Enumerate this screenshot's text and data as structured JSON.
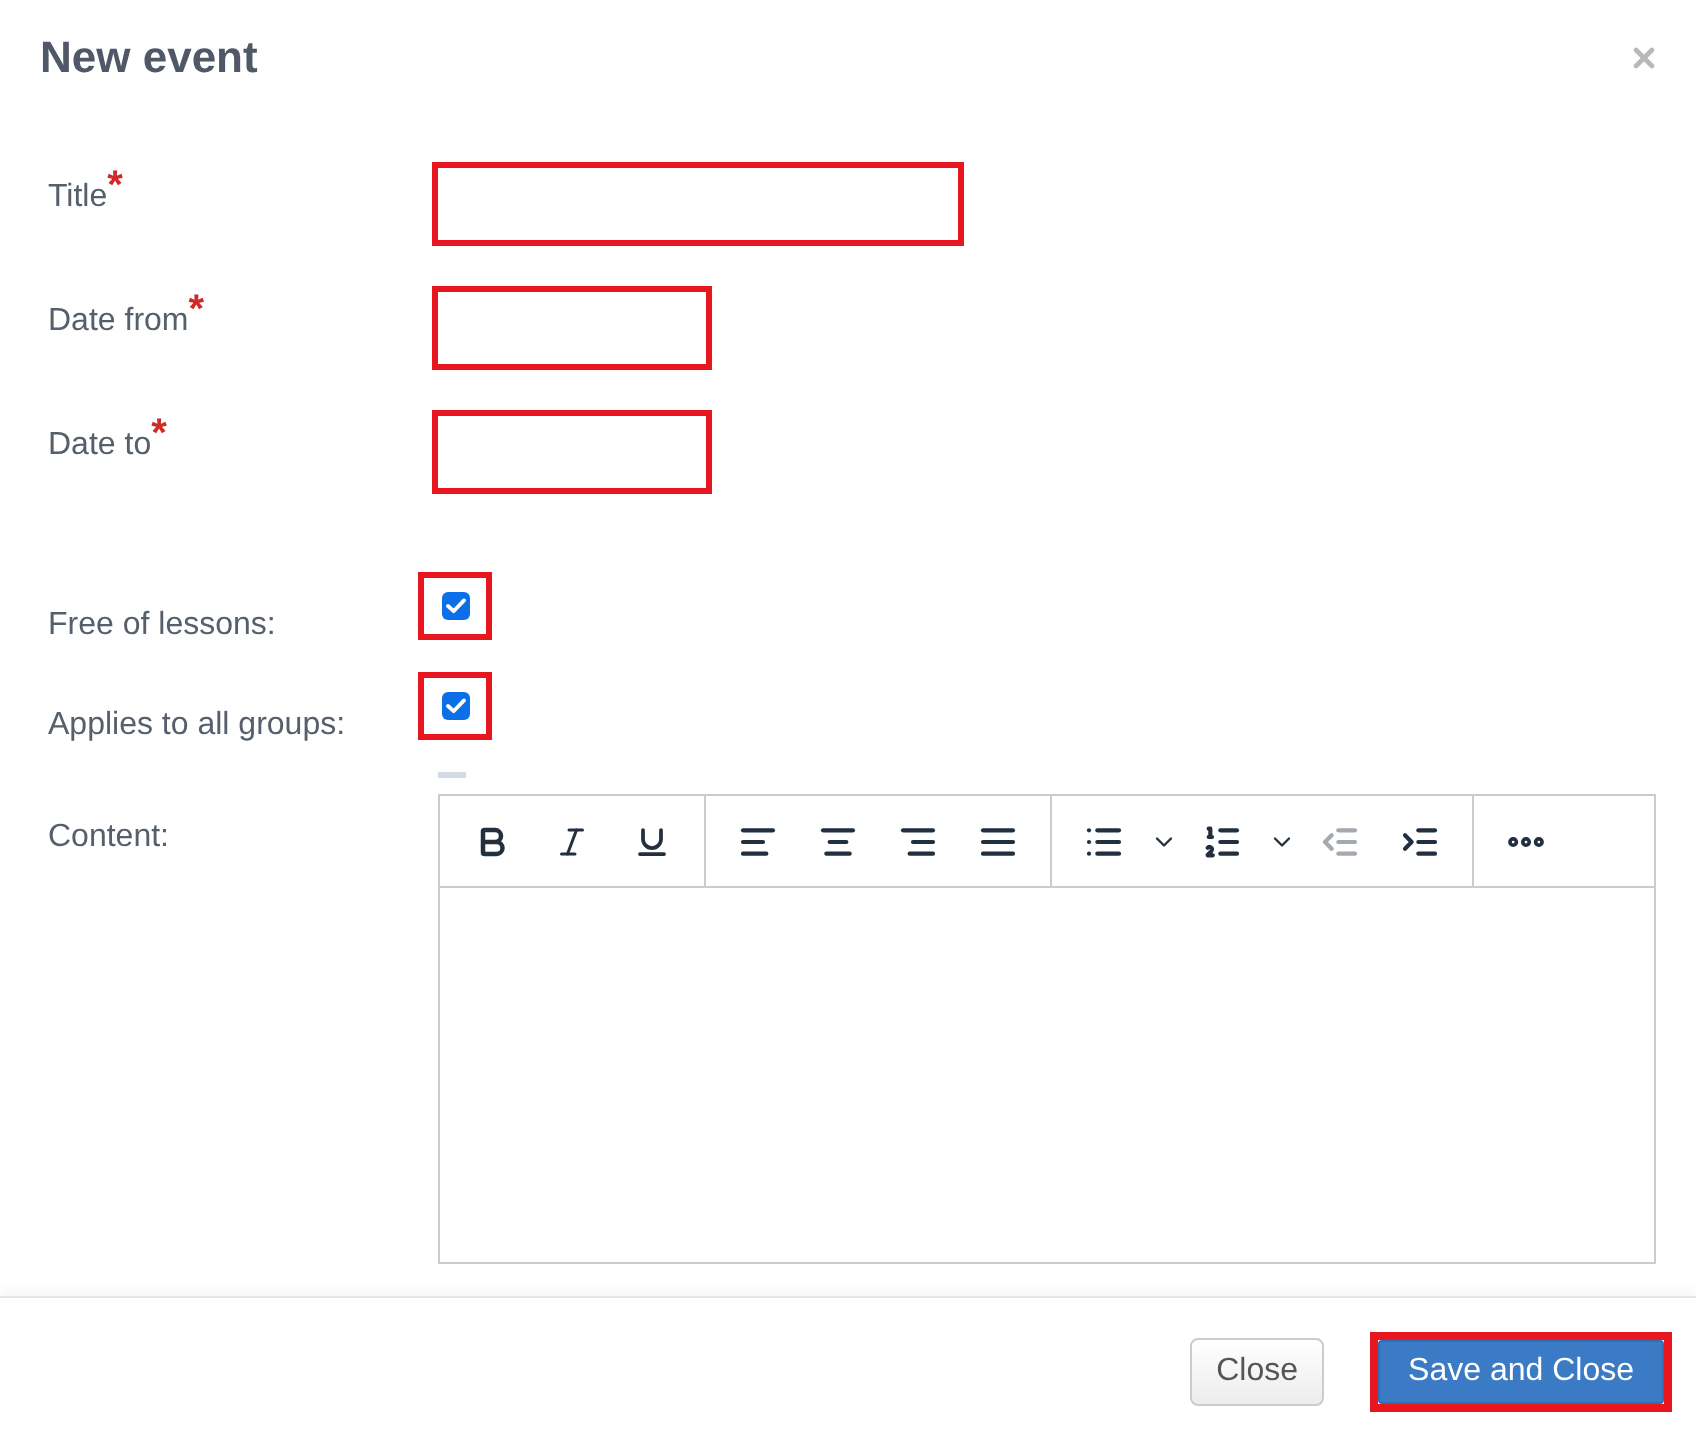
{
  "dialog": {
    "title": "New event"
  },
  "fields": [
    {
      "kind": "text",
      "label": "Title",
      "required_mark": "*",
      "highlighted": true
    },
    {
      "kind": "date",
      "label": "Date from",
      "required_mark": "*",
      "highlighted": true
    },
    {
      "kind": "date",
      "label": "Date to",
      "required_mark": "*",
      "highlighted": true
    }
  ],
  "checkboxes": [
    {
      "label": "Free of lessons:",
      "checked": true,
      "highlighted": true
    },
    {
      "label": "Applies to all groups:",
      "checked": true,
      "highlighted": true
    }
  ],
  "editor": {
    "label": "Content:",
    "toolbar": [
      {
        "items": [
          {
            "kind": "bold",
            "disabled": false
          },
          {
            "kind": "italic",
            "disabled": false
          },
          {
            "kind": "underline",
            "disabled": false
          }
        ]
      },
      {
        "items": [
          {
            "kind": "align_left",
            "disabled": false
          },
          {
            "kind": "align_center",
            "disabled": false
          },
          {
            "kind": "align_right",
            "disabled": false
          },
          {
            "kind": "align_justify",
            "disabled": false
          }
        ]
      },
      {
        "items": [
          {
            "kind": "bullet_list",
            "disabled": false
          },
          {
            "kind": "dropdown",
            "disabled": false
          },
          {
            "kind": "numbered_list",
            "disabled": false
          },
          {
            "kind": "dropdown",
            "disabled": false
          },
          {
            "kind": "outdent",
            "disabled": true
          },
          {
            "kind": "indent",
            "disabled": false
          }
        ]
      },
      {
        "items": [
          {
            "kind": "more",
            "disabled": false
          }
        ]
      }
    ]
  },
  "buttons": [
    {
      "kind": "secondary",
      "label": "Close",
      "highlighted": false
    },
    {
      "kind": "primary",
      "label": "Save and Close",
      "highlighted": true
    }
  ]
}
